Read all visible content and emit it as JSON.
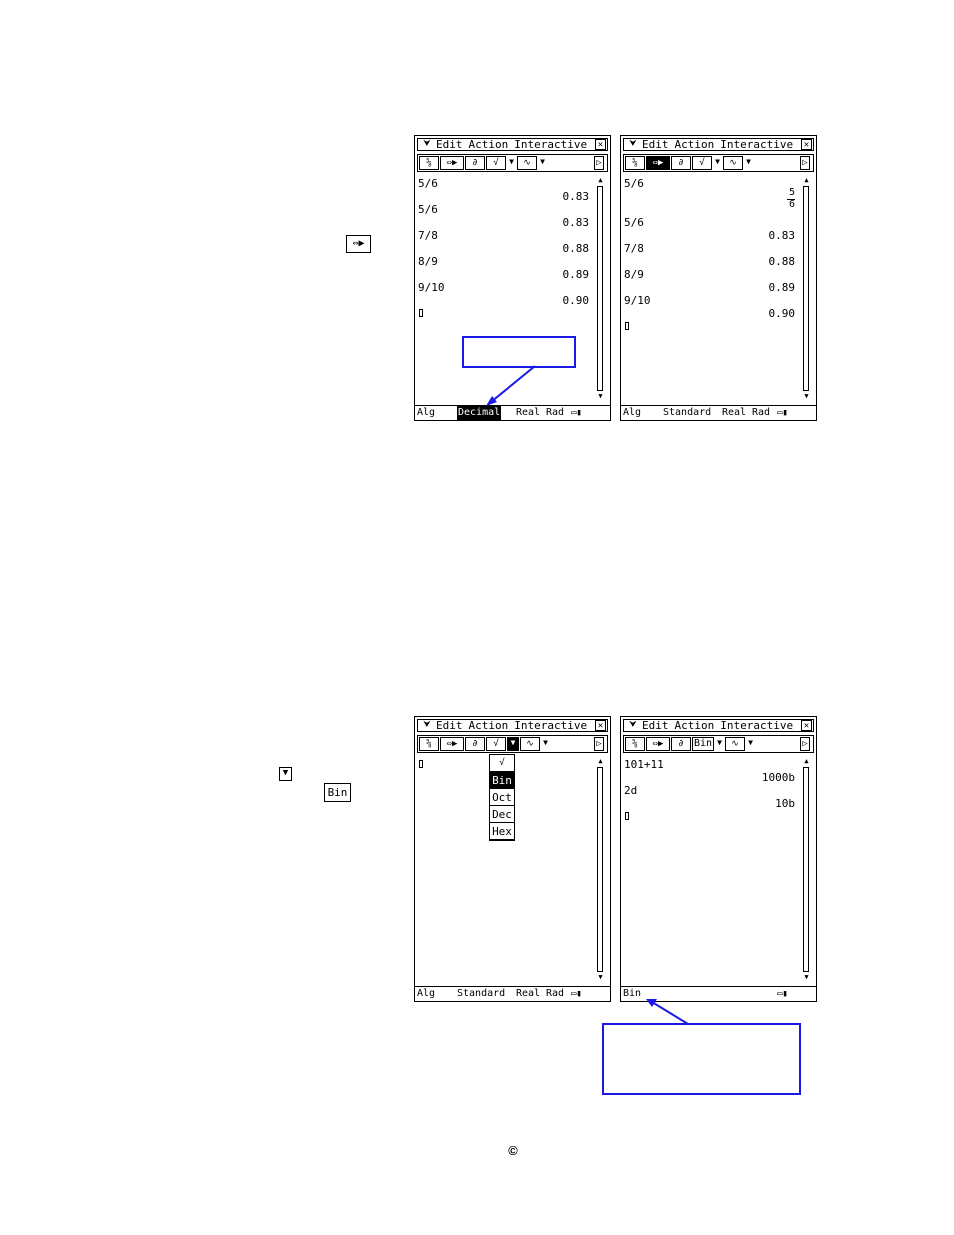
{
  "menu": {
    "items": [
      "Edit",
      "Action",
      "Interactive"
    ]
  },
  "toolbar": {
    "mode_bin_label": "Bin"
  },
  "screen1": {
    "lines": [
      {
        "input": "5/6",
        "result": "0.83"
      },
      {
        "input": "5/6",
        "result": "0.83"
      },
      {
        "input": "7/8",
        "result": "0.88"
      },
      {
        "input": "8/9",
        "result": "0.89"
      },
      {
        "input": "9/10",
        "result": "0.90"
      }
    ],
    "status": {
      "mode": "Alg",
      "format": "Decimal",
      "real": "Real",
      "angle": "Rad"
    }
  },
  "screen2": {
    "lines": [
      {
        "input": "5/6",
        "result_num": "5",
        "result_den": "6"
      },
      {
        "input": "5/6",
        "result": "0.83"
      },
      {
        "input": "7/8",
        "result": "0.88"
      },
      {
        "input": "8/9",
        "result": "0.89"
      },
      {
        "input": "9/10",
        "result": "0.90"
      }
    ],
    "status": {
      "mode": "Alg",
      "format": "Standard",
      "real": "Real",
      "angle": "Rad"
    }
  },
  "screen3": {
    "dropdown": [
      "Bin",
      "Oct",
      "Dec",
      "Hex"
    ],
    "status": {
      "mode": "Alg",
      "format": "Standard",
      "real": "Real",
      "angle": "Rad"
    }
  },
  "screen4": {
    "lines": [
      {
        "input": "101+11",
        "result": "1000b"
      },
      {
        "input": "2d",
        "result": "10b"
      }
    ],
    "status": {
      "mode": "Bin"
    }
  },
  "side_icons": {
    "bin_button": "Bin"
  },
  "footer": {
    "copyright": "©"
  },
  "colors": {
    "callout": "#1a1ae6"
  }
}
